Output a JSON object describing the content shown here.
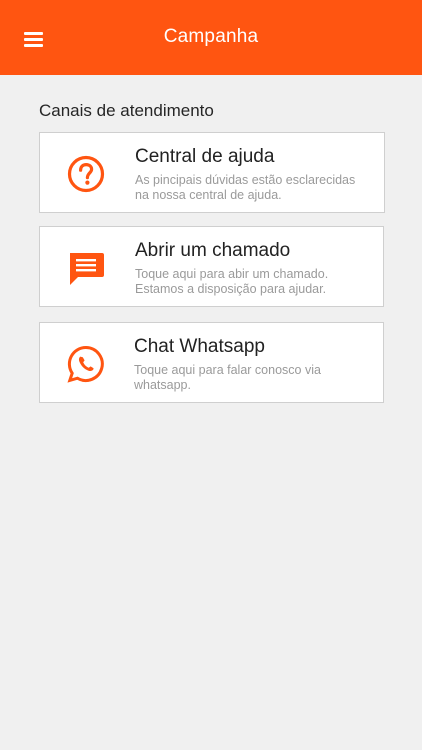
{
  "appbar": {
    "title": "Campanha",
    "menu_icon": "hamburger-menu-icon"
  },
  "section": {
    "title": "Canais de atendimento"
  },
  "channels": [
    {
      "icon": "help-circle-icon",
      "title": "Central de ajuda",
      "description": "As pincipais dúvidas estão esclarecidas na nossa central de ajuda."
    },
    {
      "icon": "chat-message-icon",
      "title": "Abrir um chamado",
      "description": "Toque aqui para abir um chamado. Estamos a disposição para ajudar."
    },
    {
      "icon": "whatsapp-icon",
      "title": "Chat Whatsapp",
      "description": "Toque aqui para falar conosco via whatsapp."
    }
  ],
  "colors": {
    "accent": "#ff5511",
    "background": "#f0f0f0",
    "card": "#ffffff"
  }
}
